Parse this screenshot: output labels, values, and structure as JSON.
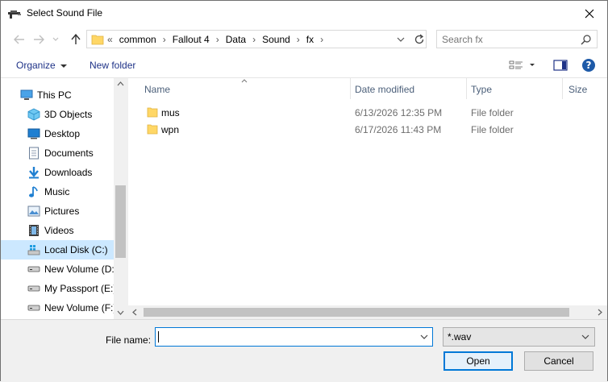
{
  "window": {
    "title": "Select Sound File",
    "icon": "gun-icon"
  },
  "address": {
    "overflow": "«",
    "crumbs": [
      "common",
      "Fallout 4",
      "Data",
      "Sound",
      "fx"
    ],
    "separator": "›"
  },
  "search": {
    "placeholder": "Search fx"
  },
  "toolbar": {
    "organize_label": "Organize",
    "new_folder_label": "New folder"
  },
  "sidebar": {
    "items": [
      {
        "label": "This PC",
        "icon": "computer-icon",
        "level": 0
      },
      {
        "label": "3D Objects",
        "icon": "cube-icon",
        "level": 1
      },
      {
        "label": "Desktop",
        "icon": "desktop-icon",
        "level": 1
      },
      {
        "label": "Documents",
        "icon": "documents-icon",
        "level": 1
      },
      {
        "label": "Downloads",
        "icon": "download-arrow-icon",
        "level": 1
      },
      {
        "label": "Music",
        "icon": "music-note-icon",
        "level": 1
      },
      {
        "label": "Pictures",
        "icon": "pictures-icon",
        "level": 1
      },
      {
        "label": "Videos",
        "icon": "film-icon",
        "level": 1
      },
      {
        "label": "Local Disk (C:)",
        "icon": "windows-drive-icon",
        "level": 1,
        "selected": true
      },
      {
        "label": "New Volume (D:",
        "icon": "drive-icon",
        "level": 1
      },
      {
        "label": "My Passport (E:)",
        "icon": "drive-icon",
        "level": 1
      },
      {
        "label": "New Volume (F:)",
        "icon": "drive-icon",
        "level": 1
      }
    ]
  },
  "file_list": {
    "columns": [
      "Name",
      "Date modified",
      "Type",
      "Size"
    ],
    "rows": [
      {
        "name": "mus",
        "date": "6/13/2026 12:35 PM",
        "type": "File folder"
      },
      {
        "name": "wpn",
        "date": "6/17/2026 11:43 PM",
        "type": "File folder"
      }
    ]
  },
  "bottom": {
    "file_name_label": "File name:",
    "file_name_value": "",
    "filter_value": "*.wav",
    "open_label": "Open",
    "cancel_label": "Cancel"
  },
  "colors": {
    "accent": "#0078d7",
    "selected_bg": "#cce8ff",
    "link": "#1e3287",
    "folder": "#ffd766"
  }
}
